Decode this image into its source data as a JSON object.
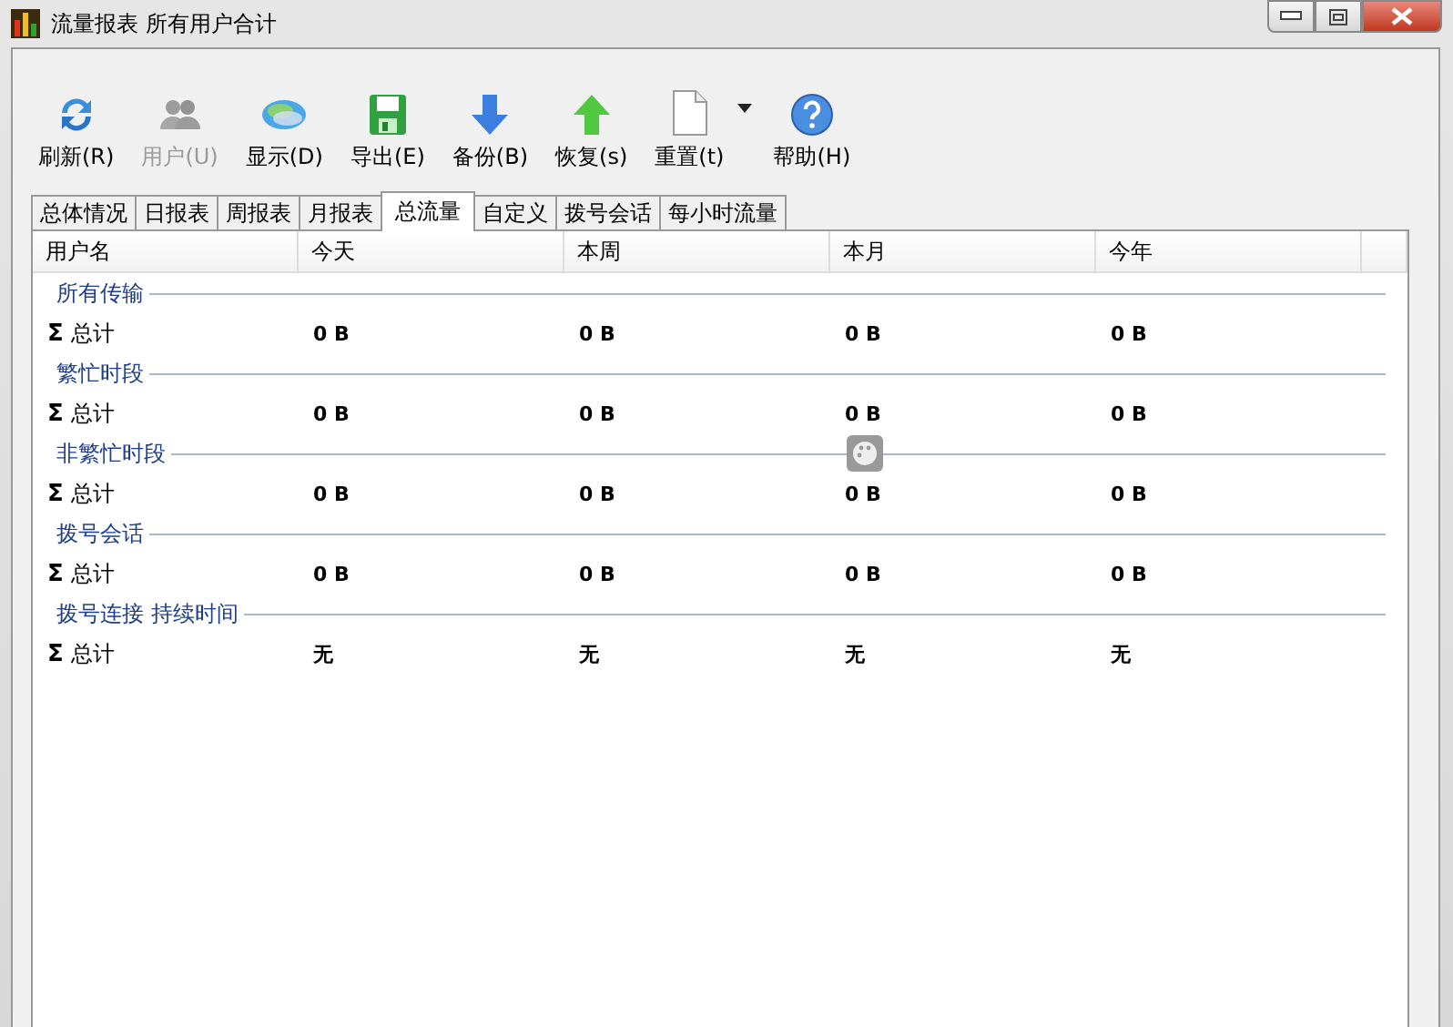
{
  "window": {
    "title": "流量报表 所有用户合计"
  },
  "toolbar": [
    {
      "kind": "refresh",
      "label": "刷新(R)",
      "disabled": false
    },
    {
      "kind": "users",
      "label": "用户(U)",
      "disabled": true
    },
    {
      "kind": "display",
      "label": "显示(D)",
      "disabled": false
    },
    {
      "kind": "export",
      "label": "导出(E)",
      "disabled": false
    },
    {
      "kind": "backup",
      "label": "备份(B)",
      "disabled": false
    },
    {
      "kind": "restore",
      "label": "恢复(s)",
      "disabled": false
    },
    {
      "kind": "reset",
      "label": "重置(t)",
      "disabled": false,
      "dropdown": true
    },
    {
      "kind": "help",
      "label": "帮助(H)",
      "disabled": false
    }
  ],
  "tabs": [
    {
      "label": "总体情况",
      "selected": false
    },
    {
      "label": "日报表",
      "selected": false
    },
    {
      "label": "周报表",
      "selected": false
    },
    {
      "label": "月报表",
      "selected": false
    },
    {
      "label": "总流量",
      "selected": true
    },
    {
      "label": "自定义",
      "selected": false
    },
    {
      "label": "拨号会话",
      "selected": false
    },
    {
      "label": "每小时流量",
      "selected": false
    }
  ],
  "table": {
    "columns": [
      "用户名",
      "今天",
      "本周",
      "本月",
      "今年"
    ],
    "groups": [
      {
        "title": "所有传输",
        "rows": [
          {
            "sigma": "Σ",
            "label": "总计",
            "values": [
              "0 B",
              "0 B",
              "0 B",
              "0 B"
            ]
          }
        ]
      },
      {
        "title": "繁忙时段",
        "rows": [
          {
            "sigma": "Σ",
            "label": "总计",
            "values": [
              "0 B",
              "0 B",
              "0 B",
              "0 B"
            ]
          }
        ]
      },
      {
        "title": "非繁忙时段",
        "rows": [
          {
            "sigma": "Σ",
            "label": "总计",
            "values": [
              "0 B",
              "0 B",
              "0 B",
              "0 B"
            ]
          }
        ]
      },
      {
        "title": "拨号会话",
        "rows": [
          {
            "sigma": "Σ",
            "label": "总计",
            "values": [
              "0 B",
              "0 B",
              "0 B",
              "0 B"
            ]
          }
        ]
      },
      {
        "title": "拨号连接 持续时间",
        "rows": [
          {
            "sigma": "Σ",
            "label": "总计",
            "values": [
              "无",
              "无",
              "无",
              "无"
            ]
          }
        ]
      }
    ]
  }
}
